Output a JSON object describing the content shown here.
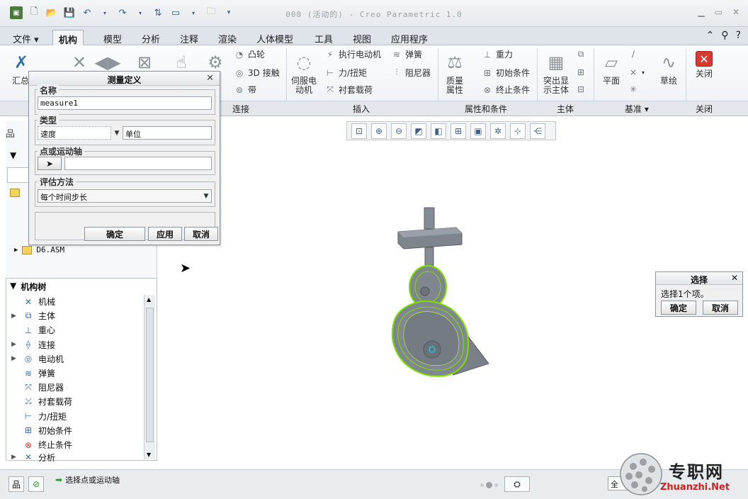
{
  "app": {
    "title": "000 (活动的) - Creo Parametric 1.0"
  },
  "tabs": [
    {
      "label": "文件 ▾"
    },
    {
      "label": "机构"
    },
    {
      "label": "模型"
    },
    {
      "label": "分析"
    },
    {
      "label": "注释"
    },
    {
      "label": "渲染"
    },
    {
      "label": "人体模型"
    },
    {
      "label": "工具"
    },
    {
      "label": "视图"
    },
    {
      "label": "应用程序"
    }
  ],
  "ribbon": {
    "summary_label": "汇总",
    "connect": {
      "cam": "凸轮",
      "contact3d": "3D 接触",
      "belt": "带"
    },
    "insert": {
      "servo_motor": "伺服电\n动机",
      "exec_motor": "执行电动机",
      "force_torque": "力/扭矩",
      "bushing_load": "衬套载荷",
      "spring": "弹簧",
      "damper": "阻尼器"
    },
    "props": {
      "mass_props": "质量\n属性",
      "gravity": "重力",
      "init_cond": "初始条件",
      "term_cond": "终止条件"
    },
    "body": {
      "highlight_bodies": "突出显\n示主体"
    },
    "datum": {
      "plane": "平面",
      "sketch": "草绘"
    },
    "close": {
      "label": "关闭"
    },
    "groups": {
      "connect": "连接",
      "insert": "插入",
      "props": "属性和条件",
      "body": "主体",
      "datum": "基准 ▾",
      "close": "关闭"
    }
  },
  "model_tree": {
    "asm_name": "D6.ASM"
  },
  "mech_tree": {
    "header": "机构树",
    "items": [
      {
        "label": "机械",
        "icon": "mechanism-icon",
        "expand": ""
      },
      {
        "label": "主体",
        "icon": "body-icon",
        "expand": "▶"
      },
      {
        "label": "重心",
        "icon": "gravity-icon",
        "expand": ""
      },
      {
        "label": "连接",
        "icon": "connection-icon",
        "expand": "▶"
      },
      {
        "label": "电动机",
        "icon": "motor-icon",
        "expand": "▶"
      },
      {
        "label": "弹簧",
        "icon": "spring-icon",
        "expand": ""
      },
      {
        "label": "阻尼器",
        "icon": "damper-icon",
        "expand": ""
      },
      {
        "label": "衬套载荷",
        "icon": "bushing-icon",
        "expand": ""
      },
      {
        "label": "力/扭矩",
        "icon": "force-icon",
        "expand": ""
      },
      {
        "label": "初始条件",
        "icon": "init-cond-icon",
        "expand": ""
      },
      {
        "label": "终止条件",
        "icon": "term-cond-icon",
        "expand": ""
      },
      {
        "label": "分析",
        "icon": "analysis-icon",
        "expand": "▶"
      }
    ]
  },
  "measure_dialog": {
    "title": "测量定义",
    "name_legend": "名称",
    "name_value": "measure1",
    "type_legend": "类型",
    "type_value": "速度",
    "unit_value": "单位",
    "point_legend": "点或运动轴",
    "point_value": "",
    "eval_legend": "评估方法",
    "eval_value": "每个时间步长",
    "ok": "确定",
    "apply": "应用",
    "cancel": "取消"
  },
  "select_dialog": {
    "title": "选择",
    "message": "选择1个项。",
    "ok": "确定",
    "cancel": "取消"
  },
  "status": {
    "message": "选择点或运动轴",
    "filter_value": "全"
  },
  "watermark": {
    "cn": "专职网",
    "en": "Zhuanzhi.Net"
  },
  "colors": {
    "accent": "#3a5f8c",
    "highlight_green": "#7be000",
    "model_gray": "#7e858c"
  }
}
